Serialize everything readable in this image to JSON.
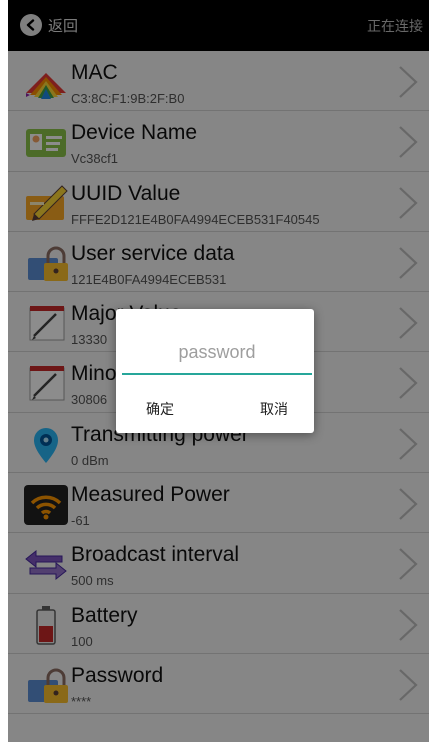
{
  "header": {
    "back_label": "返回",
    "status": "正在连接"
  },
  "rows": [
    {
      "title": "MAC",
      "value": "C3:8C:F1:9B:2F:B0",
      "icon": "rainbow-fan-icon"
    },
    {
      "title": "Device Name",
      "value": "Vc38cf1",
      "icon": "id-card-icon"
    },
    {
      "title": "UUID Value",
      "value": "FFFE2D121E4B0FA4994ECEB531F40545",
      "icon": "pencil-card-icon"
    },
    {
      "title": "User service data",
      "value": "121E4B0FA4994ECEB531",
      "icon": "lock-card-icon"
    },
    {
      "title": "Major Value",
      "value": "13330",
      "icon": "notepad-pen-icon"
    },
    {
      "title": "Minor Value",
      "value": "30806",
      "icon": "notepad-pen-icon"
    },
    {
      "title": "Transmitting power",
      "value": "0 dBm",
      "icon": "location-pin-icon"
    },
    {
      "title": "Measured Power",
      "value": "-61",
      "icon": "wifi-signal-icon"
    },
    {
      "title": "Broadcast interval",
      "value": "500 ms",
      "icon": "double-arrow-icon"
    },
    {
      "title": "Battery",
      "value": "100",
      "icon": "battery-icon"
    },
    {
      "title": "Password",
      "value": "****",
      "icon": "lock-card-icon"
    }
  ],
  "dialog": {
    "placeholder": "password",
    "ok_label": "确定",
    "cancel_label": "取消",
    "accent": "#26a69a"
  }
}
